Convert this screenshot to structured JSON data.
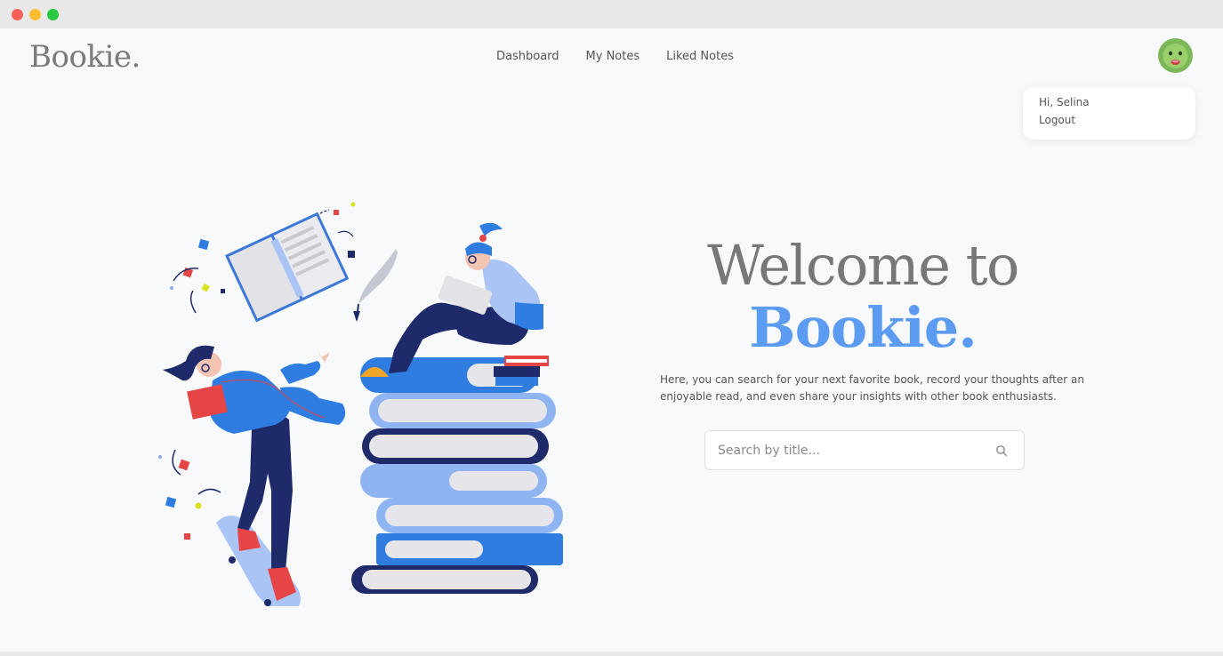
{
  "app": {
    "logo": "Bookie."
  },
  "nav": {
    "items": [
      {
        "label": "Dashboard"
      },
      {
        "label": "My Notes"
      },
      {
        "label": "Liked Notes"
      }
    ]
  },
  "user_menu": {
    "greeting": "Hi, Selina",
    "logout_label": "Logout"
  },
  "hero": {
    "title_line1": "Welcome to",
    "title_line2": "Bookie.",
    "description": "Here, you can search for your next favorite book, record your thoughts after an enjoyable read, and even share your insights with other book enthusiasts."
  },
  "search": {
    "placeholder": "Search by title...",
    "value": "",
    "icon": "search-icon"
  },
  "colors": {
    "accent": "#5b9bf1",
    "logo_gray": "#7a7a7a",
    "background": "#f8f9fb"
  }
}
